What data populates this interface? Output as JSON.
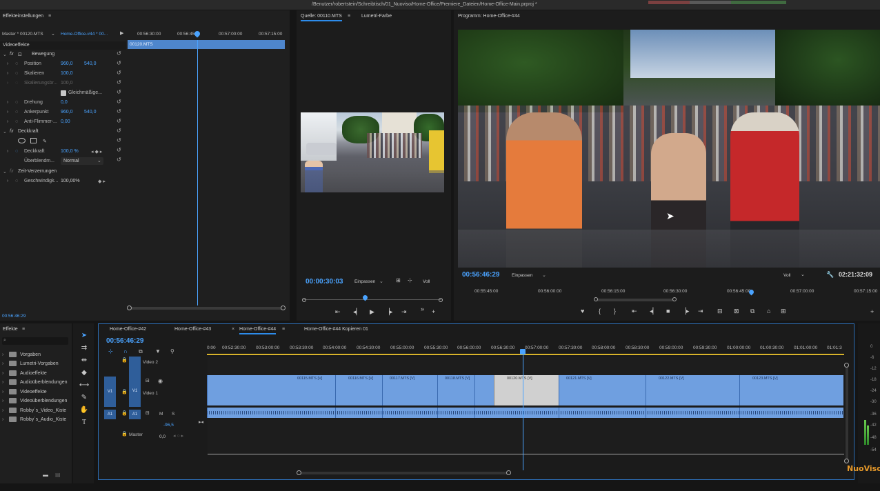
{
  "app": {
    "title": "/Benutzer/robertstein/Schreibtisch/01_Nuoviso/Home-Office/Premiere_Dateien/Home-Office-Main.prproj *"
  },
  "effect_controls": {
    "tab": "Effekteinstellungen",
    "master_label": "Master * 00120.MTS",
    "sequence_label": "Home-Office-#44 * 00...",
    "ruler": [
      "00:56:30:00",
      "00:56:45",
      "00:57:00:00",
      "00:57:15:00"
    ],
    "clip_name": "00120.MTS",
    "section_video": "Videoeffekte",
    "motion": "Bewegung",
    "position": {
      "label": "Position",
      "x": "960,0",
      "y": "540,0"
    },
    "scale": {
      "label": "Skalieren",
      "value": "100,0"
    },
    "scale_width": {
      "label": "Skalierungsbr...",
      "value": "100,0"
    },
    "uniform": "Gleichmäßige...",
    "rotation": {
      "label": "Drehung",
      "value": "0,0"
    },
    "anchor": {
      "label": "Ankerpunkt",
      "x": "960,0",
      "y": "540,0"
    },
    "flicker": {
      "label": "Anti-Flimmer-...",
      "value": "0,00"
    },
    "opacity_section": "Deckkraft",
    "opacity": {
      "label": "Deckkraft",
      "value": "100,0 %"
    },
    "blend": {
      "label": "Überblendm...",
      "value": "Normal"
    },
    "time_remap": "Zeit-Verzerrungen",
    "speed": {
      "label": "Geschwindigk...",
      "value": "100,00%"
    },
    "timecode": "00:56:46:29"
  },
  "source": {
    "tab": "Quelle: 00110.MTS",
    "tab2": "Lumetri-Farbe",
    "timecode": "00:00:30:03",
    "fit": "Einpassen",
    "quality": "Voll"
  },
  "program": {
    "tab": "Programm: Home-Office-#44",
    "timecode": "00:56:46:29",
    "fit": "Einpassen",
    "quality": "Voll",
    "duration": "02:21:32:09",
    "ruler": [
      "00:55:45:00",
      "00:56:00:00",
      "00:56:15:00",
      "00:56:30:00",
      "00:56:45:00",
      "00:57:00:00",
      "00:57:15:00"
    ]
  },
  "effects_panel": {
    "tab": "Effekte",
    "items": [
      "Vorgaben",
      "Lumetri-Vorgaben",
      "Audioeffekte",
      "Audioüberblendungen",
      "Videoeffekte",
      "Videoüberblendungen",
      "Robby´s_Video_Kiste",
      "Robby´s_Audio_Kiste"
    ]
  },
  "timeline": {
    "tabs": [
      "Home-Office-#42",
      "Home-Office-#43",
      "Home-Office-#44",
      "Home-Office-#44 Kopieren 01"
    ],
    "timecode": "00:56:46:29",
    "ruler": [
      "0:00",
      "00:52:30:00",
      "00:53:00:00",
      "00:53:30:00",
      "00:54:00:00",
      "00:54:30:00",
      "00:55:00:00",
      "00:55:30:00",
      "00:56:00:00",
      "00:56:30:00",
      "00:57:00:00",
      "00:57:30:00",
      "00:58:00:00",
      "00:58:30:00",
      "00:59:00:00",
      "00:59:30:00",
      "01:00:00:00",
      "01:00:30:00",
      "01:01:00:00",
      "01:01:3"
    ],
    "tracks": {
      "v2": "V2",
      "v2_name": "Video 2",
      "v1": "V1",
      "v1_name": "Video 1",
      "v1_src": "V1",
      "a1": "A1",
      "a1_src": "A1",
      "m": "M",
      "s": "S",
      "volume": "-96,5",
      "master": "Master",
      "master_value": "0,0"
    },
    "clips": [
      "00115.MTS [V]",
      "00116.MTS [V]",
      "00117.MTS [V]",
      "00118.MTS [V]",
      "00120.MTS [V]",
      "00121.MTS [V]",
      "00122.MTS [V]",
      "00123.MTS [V]"
    ]
  },
  "meter": {
    "ticks": [
      "0",
      "-6",
      "-12",
      "-18",
      "-24",
      "-30",
      "-36",
      "-42",
      "-48",
      "-54"
    ]
  },
  "watermark": "NuoViso"
}
